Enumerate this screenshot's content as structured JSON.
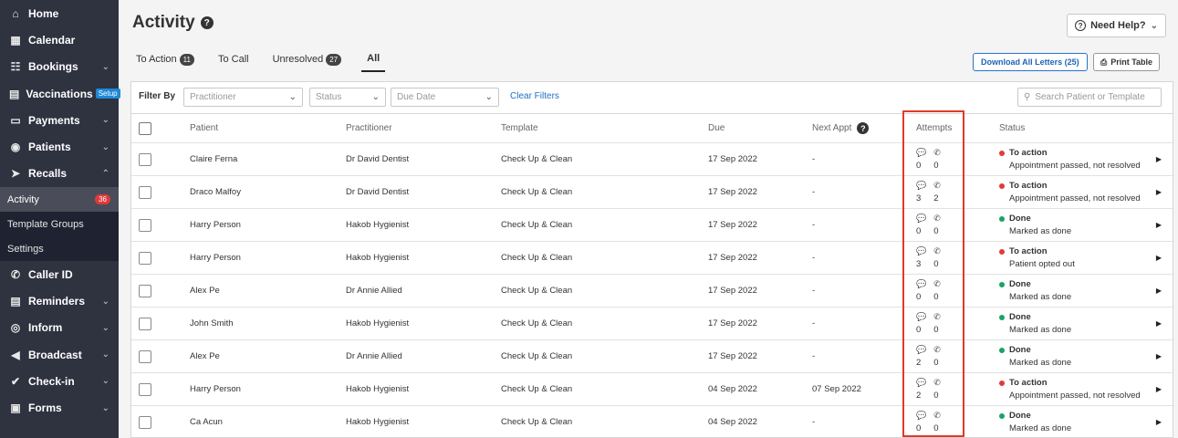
{
  "sidebar": {
    "items": [
      {
        "label": "Home",
        "icon": "home-icon",
        "glyph": "⌂",
        "chevron": ""
      },
      {
        "label": "Calendar",
        "icon": "calendar-icon",
        "glyph": "▦",
        "chevron": ""
      },
      {
        "label": "Bookings",
        "icon": "bookings-icon",
        "glyph": "☷",
        "chevron": "⌄"
      },
      {
        "label": "Vaccinations",
        "icon": "vaccinations-icon",
        "glyph": "▤",
        "chevron": "",
        "badge": "Setup"
      },
      {
        "label": "Payments",
        "icon": "payments-icon",
        "glyph": "▭",
        "chevron": "⌄"
      },
      {
        "label": "Patients",
        "icon": "patients-icon",
        "glyph": "◉",
        "chevron": "⌄"
      },
      {
        "label": "Recalls",
        "icon": "recalls-icon",
        "glyph": "➤",
        "chevron": "⌃"
      }
    ],
    "subitems": [
      {
        "label": "Activity",
        "count": "36",
        "active": true
      },
      {
        "label": "Template Groups"
      },
      {
        "label": "Settings"
      }
    ],
    "items_after": [
      {
        "label": "Caller ID",
        "icon": "phone-icon",
        "glyph": "✆",
        "chevron": ""
      },
      {
        "label": "Reminders",
        "icon": "reminders-icon",
        "glyph": "▤",
        "chevron": "⌄"
      },
      {
        "label": "Inform",
        "icon": "inform-icon",
        "glyph": "◎",
        "chevron": "⌄"
      },
      {
        "label": "Broadcast",
        "icon": "broadcast-icon",
        "glyph": "◀",
        "chevron": "⌄"
      },
      {
        "label": "Check-in",
        "icon": "check-in-icon",
        "glyph": "✔",
        "chevron": "⌄"
      },
      {
        "label": "Forms",
        "icon": "forms-icon",
        "glyph": "▣",
        "chevron": "⌄"
      }
    ]
  },
  "header": {
    "title": "Activity",
    "help_label": "Need Help?"
  },
  "tabs": [
    {
      "label": "To Action",
      "count": "11"
    },
    {
      "label": "To Call",
      "count": ""
    },
    {
      "label": "Unresolved",
      "count": "27"
    },
    {
      "label": "All",
      "count": "",
      "active": true
    }
  ],
  "actions": {
    "download_label": "Download All Letters (25)",
    "print_label": "Print Table"
  },
  "filters": {
    "label": "Filter By",
    "practitioner_placeholder": "Practitioner",
    "status_placeholder": "Status",
    "due_date_placeholder": "Due Date",
    "clear_label": "Clear Filters",
    "search_placeholder": "Search Patient or Template"
  },
  "table": {
    "headers": {
      "patient": "Patient",
      "practitioner": "Practitioner",
      "template": "Template",
      "due": "Due",
      "next_appt": "Next Appt",
      "attempts": "Attempts",
      "status": "Status"
    },
    "rows": [
      {
        "patient": "Claire Ferna",
        "practitioner": "Dr David Dentist",
        "template": "Check Up & Clean",
        "due": "17 Sep 2022",
        "next_appt": "-",
        "sms": "0",
        "calls": "0",
        "status": "To action",
        "status_color": "#e03a3a",
        "detail": "Appointment passed, not resolved"
      },
      {
        "patient": "Draco Malfoy",
        "practitioner": "Dr David Dentist",
        "template": "Check Up & Clean",
        "due": "17 Sep 2022",
        "next_appt": "-",
        "sms": "3",
        "calls": "2",
        "status": "To action",
        "status_color": "#e03a3a",
        "detail": "Appointment passed, not resolved"
      },
      {
        "patient": "Harry Person",
        "practitioner": "Hakob Hygienist",
        "template": "Check Up & Clean",
        "due": "17 Sep 2022",
        "next_appt": "-",
        "sms": "0",
        "calls": "0",
        "status": "Done",
        "status_color": "#1aa364",
        "detail": "Marked as done"
      },
      {
        "patient": "Harry Person",
        "practitioner": "Hakob Hygienist",
        "template": "Check Up & Clean",
        "due": "17 Sep 2022",
        "next_appt": "-",
        "sms": "3",
        "calls": "0",
        "status": "To action",
        "status_color": "#e03a3a",
        "detail": "Patient opted out"
      },
      {
        "patient": "Alex Pe",
        "practitioner": "Dr Annie Allied",
        "template": "Check Up & Clean",
        "due": "17 Sep 2022",
        "next_appt": "-",
        "sms": "0",
        "calls": "0",
        "status": "Done",
        "status_color": "#1aa364",
        "detail": "Marked as done"
      },
      {
        "patient": "John Smith",
        "practitioner": "Hakob Hygienist",
        "template": "Check Up & Clean",
        "due": "17 Sep 2022",
        "next_appt": "-",
        "sms": "0",
        "calls": "0",
        "status": "Done",
        "status_color": "#1aa364",
        "detail": "Marked as done"
      },
      {
        "patient": "Alex Pe",
        "practitioner": "Dr Annie Allied",
        "template": "Check Up & Clean",
        "due": "17 Sep 2022",
        "next_appt": "-",
        "sms": "2",
        "calls": "0",
        "status": "Done",
        "status_color": "#1aa364",
        "detail": "Marked as done"
      },
      {
        "patient": "Harry Person",
        "practitioner": "Hakob Hygienist",
        "template": "Check Up & Clean",
        "due": "04 Sep 2022",
        "next_appt": "07 Sep 2022",
        "sms": "2",
        "calls": "0",
        "status": "To action",
        "status_color": "#e03a3a",
        "detail": "Appointment passed, not resolved"
      },
      {
        "patient": "Ca Acun",
        "practitioner": "Hakob Hygienist",
        "template": "Check Up & Clean",
        "due": "04 Sep 2022",
        "next_appt": "-",
        "sms": "0",
        "calls": "0",
        "status": "Done",
        "status_color": "#1aa364",
        "detail": "Marked as done"
      }
    ]
  }
}
